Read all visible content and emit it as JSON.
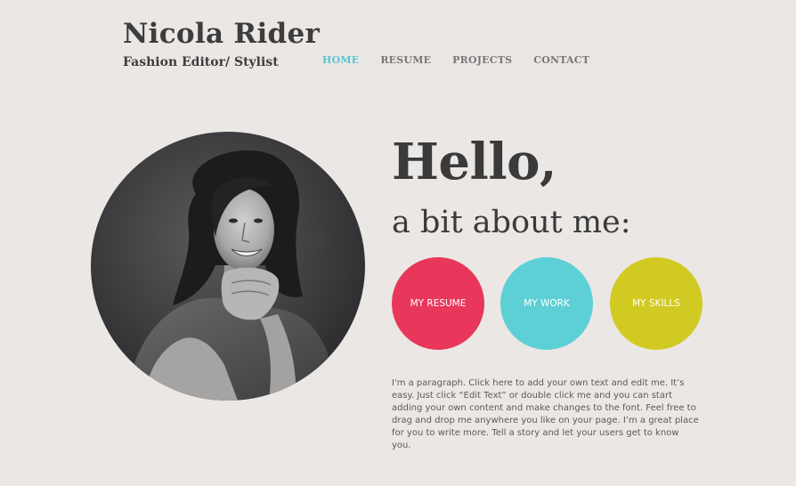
{
  "header": {
    "site_name": "Nicola Rider",
    "tagline": "Fashion Editor/ Stylist"
  },
  "nav": {
    "items": [
      {
        "label": "HOME",
        "active": true
      },
      {
        "label": "RESUME",
        "active": false
      },
      {
        "label": "PROJECTS",
        "active": false
      },
      {
        "label": "CONTACT",
        "active": false
      }
    ],
    "active_color": "#5bc3cf"
  },
  "hero": {
    "heading": "Hello,",
    "subheading": "a bit about me:",
    "portrait_alt": "portrait-photo"
  },
  "buttons": [
    {
      "label": "MY RESUME",
      "color": "#e8375a"
    },
    {
      "label": "MY WORK",
      "color": "#5dd0d6"
    },
    {
      "label": "MY SKILLS",
      "color": "#d1ca22"
    }
  ],
  "paragraph": "I'm a paragraph. Click here to add your own text and edit me. It’s easy. Just click “Edit Text” or double click me and you can start adding your own content and make changes to the font. Feel free to drag and drop me anywhere you like on your page. I’m a great place for you to write more. Tell a story and let your users get to know you.",
  "colors": {
    "background": "#ebe7e5",
    "text": "#3a3a3a"
  }
}
